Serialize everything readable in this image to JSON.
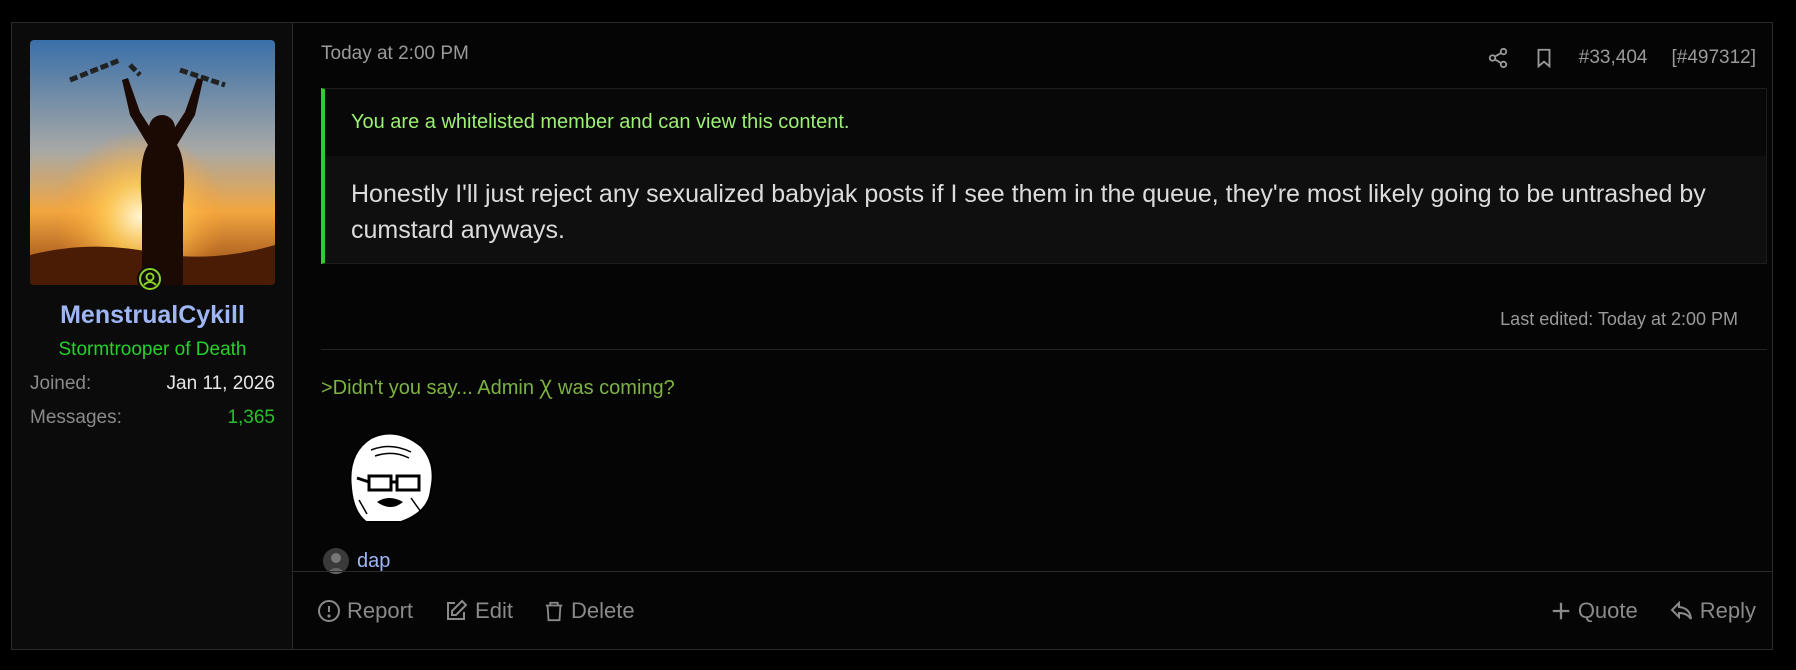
{
  "user": {
    "name": "MenstrualCykill",
    "title": "Stormtrooper of Death",
    "extras": [
      {
        "label": "Joined:",
        "value": "Jan 11, 2026"
      },
      {
        "label": "Messages:",
        "value": "1,365"
      }
    ]
  },
  "post": {
    "date": "Today at 2:00 PM",
    "number": "#33,404",
    "id": "[#497312]",
    "whitelist_notice": "You are a whitelisted member and can view this content.",
    "body": "Honestly I'll just reject any sexualized babyjak posts if I see them in the queue, they're most likely going to be untrashed by cumstard anyways.",
    "last_edited": "Last edited: Today at 2:00 PM",
    "signature": ">Didn't you say... Admin Ꭓ was coming?",
    "reaction_user": "dap"
  },
  "actions": {
    "report": "Report",
    "edit": "Edit",
    "delete": "Delete",
    "quote": "Quote",
    "reply": "Reply"
  },
  "icons": [
    "online-icon",
    "share-icon",
    "bookmark-icon",
    "report-icon",
    "edit-icon",
    "delete-icon",
    "plus-icon",
    "reply-icon"
  ],
  "colors": {
    "username": "#9fb6f5",
    "user_title": "#27d12b",
    "whitelist_border": "#2ecc2e",
    "whitelist_text": "#9cf073",
    "greentext": "#7cb342"
  }
}
